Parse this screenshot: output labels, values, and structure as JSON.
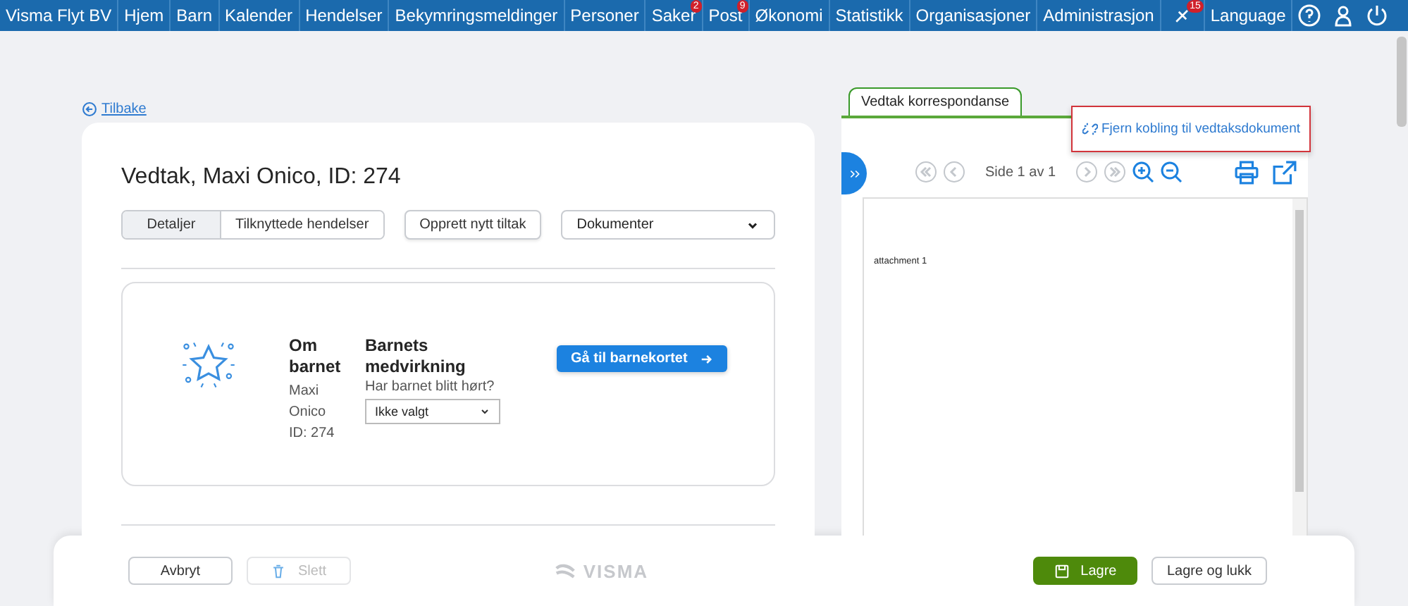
{
  "nav": {
    "brand": "Visma Flyt BV",
    "items": [
      {
        "label": "Hjem"
      },
      {
        "label": "Barn"
      },
      {
        "label": "Kalender"
      },
      {
        "label": "Hendelser"
      },
      {
        "label": "Bekymringsmeldinger"
      },
      {
        "label": "Personer"
      },
      {
        "label": "Saker",
        "badge": "2"
      },
      {
        "label": "Post",
        "badge": "9"
      },
      {
        "label": "Økonomi"
      },
      {
        "label": "Statistikk"
      },
      {
        "label": "Organisasjoner"
      },
      {
        "label": "Administrasjon"
      }
    ],
    "notifications_badge": "15",
    "language": "Language"
  },
  "back_link": "Tilbake",
  "title": "Vedtak, Maxi Onico, ID: 274",
  "tabs": [
    {
      "label": "Detaljer",
      "selected": true
    },
    {
      "label": "Tilknyttede hendelser",
      "selected": false
    }
  ],
  "create_button": "Opprett nytt tiltak",
  "documents_select": "Dokumenter",
  "child": {
    "heading": "Om barnet",
    "name": "Maxi Onico",
    "id": "ID: 274"
  },
  "participation": {
    "heading": "Barnets medvirkning",
    "question": "Har barnet blitt hørt?",
    "value": "Ikke valgt"
  },
  "child_card_button": "Gå til barnekortet",
  "panel": {
    "tab": "Vedtak korrespondanse",
    "menu_item": "Fjern kobling til vedtaksdokument",
    "page_info": "Side 1 av 1",
    "pager_disabled": true,
    "document_text": "attachment 1"
  },
  "footer": {
    "buttons": [
      {
        "label": "Avbryt",
        "kind": "plain",
        "disabled": false
      },
      {
        "label": "Slett",
        "kind": "delete",
        "disabled": true
      }
    ],
    "logo": "VISMA",
    "actions": [
      {
        "label": "Lagre",
        "kind": "primary",
        "disabled": false
      },
      {
        "label": "Lagre og lukk",
        "kind": "plain",
        "disabled": false
      }
    ]
  }
}
